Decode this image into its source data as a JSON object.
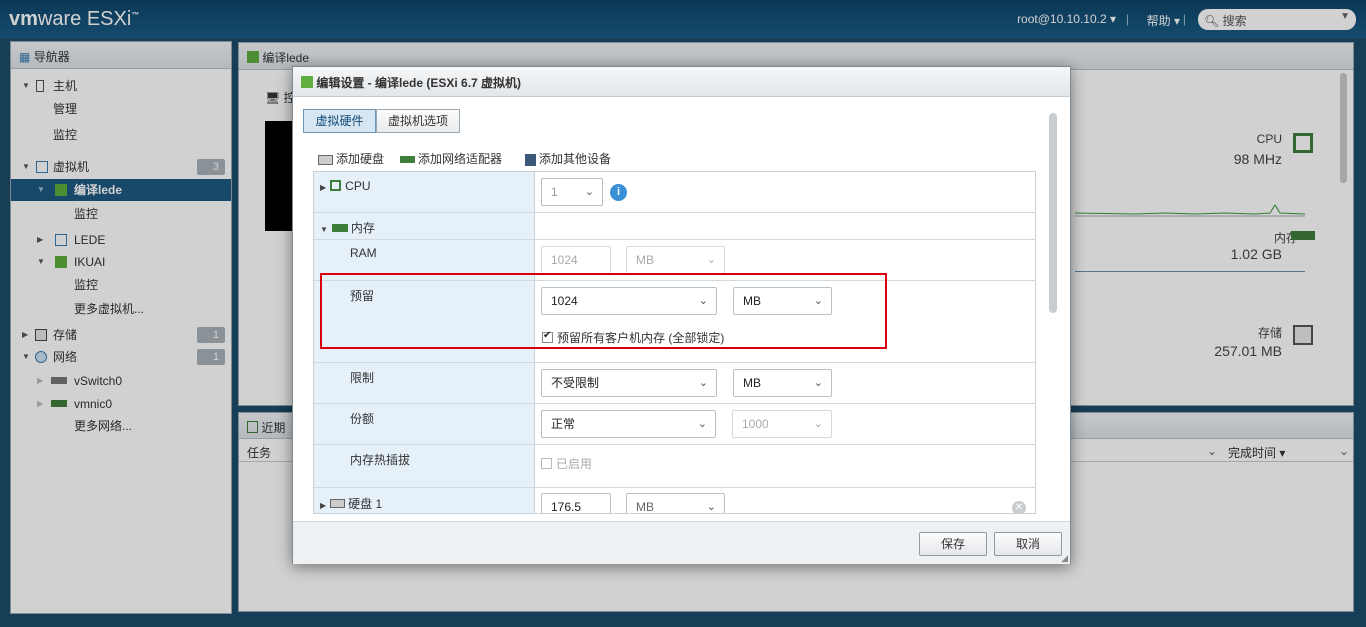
{
  "topbar": {
    "logo_vm": "vm",
    "logo_ware": "ware",
    "logo_product": " ESXi",
    "logo_tm": "™",
    "user": "root@10.10.10.2 ▾",
    "help": "帮助 ▾",
    "search_placeholder": "搜索"
  },
  "navigator": {
    "title": "导航器",
    "items": [
      {
        "label": "主机"
      },
      {
        "label": "管理"
      },
      {
        "label": "监控"
      },
      {
        "label": "虚拟机",
        "badge": "3"
      },
      {
        "label": "编译lede"
      },
      {
        "label": "监控"
      },
      {
        "label": "LEDE"
      },
      {
        "label": "IKUAI"
      },
      {
        "label": "监控"
      },
      {
        "label": "更多虚拟机..."
      },
      {
        "label": "存储",
        "badge": "1"
      },
      {
        "label": "网络",
        "badge": "1"
      },
      {
        "label": "vSwitch0"
      },
      {
        "label": "vmnic0"
      },
      {
        "label": "更多网络..."
      }
    ]
  },
  "main": {
    "title": "编译lede",
    "action_label": "控",
    "stats": {
      "cpu_label": "CPU",
      "cpu_value": "98 MHz",
      "mem_label": "内存",
      "mem_value": "1.02 GB",
      "storage_label": "存储",
      "storage_value": "257.01 MB"
    },
    "recent_title": "近期",
    "task_col": "任务",
    "complete_col": "完成时间 ▾"
  },
  "dialog": {
    "title": "编辑设置 - 编译lede (ESXi 6.7 虚拟机)",
    "tabs": [
      "虚拟硬件",
      "虚拟机选项"
    ],
    "toolbar": {
      "add_disk": "添加硬盘",
      "add_nic": "添加网络适配器",
      "add_other": "添加其他设备"
    },
    "cpu": {
      "label": "CPU",
      "value": "1"
    },
    "memory": {
      "label": "内存",
      "ram_label": "RAM",
      "ram_value": "1024",
      "ram_unit": "MB",
      "reserve_label": "预留",
      "reserve_value": "1024",
      "reserve_unit": "MB",
      "reserve_all_label": "预留所有客户机内存 (全部锁定)",
      "reserve_all_checked": true,
      "limit_label": "限制",
      "limit_value": "不受限制",
      "limit_unit": "MB",
      "shares_label": "份额",
      "shares_value": "正常",
      "shares_number": "1000",
      "hotplug_label": "内存热插拔",
      "hotplug_option": "已启用",
      "hotplug_checked": false
    },
    "disk": {
      "label": "硬盘 1",
      "value": "176.5",
      "unit": "MB"
    },
    "save_label": "保存",
    "cancel_label": "取消"
  }
}
